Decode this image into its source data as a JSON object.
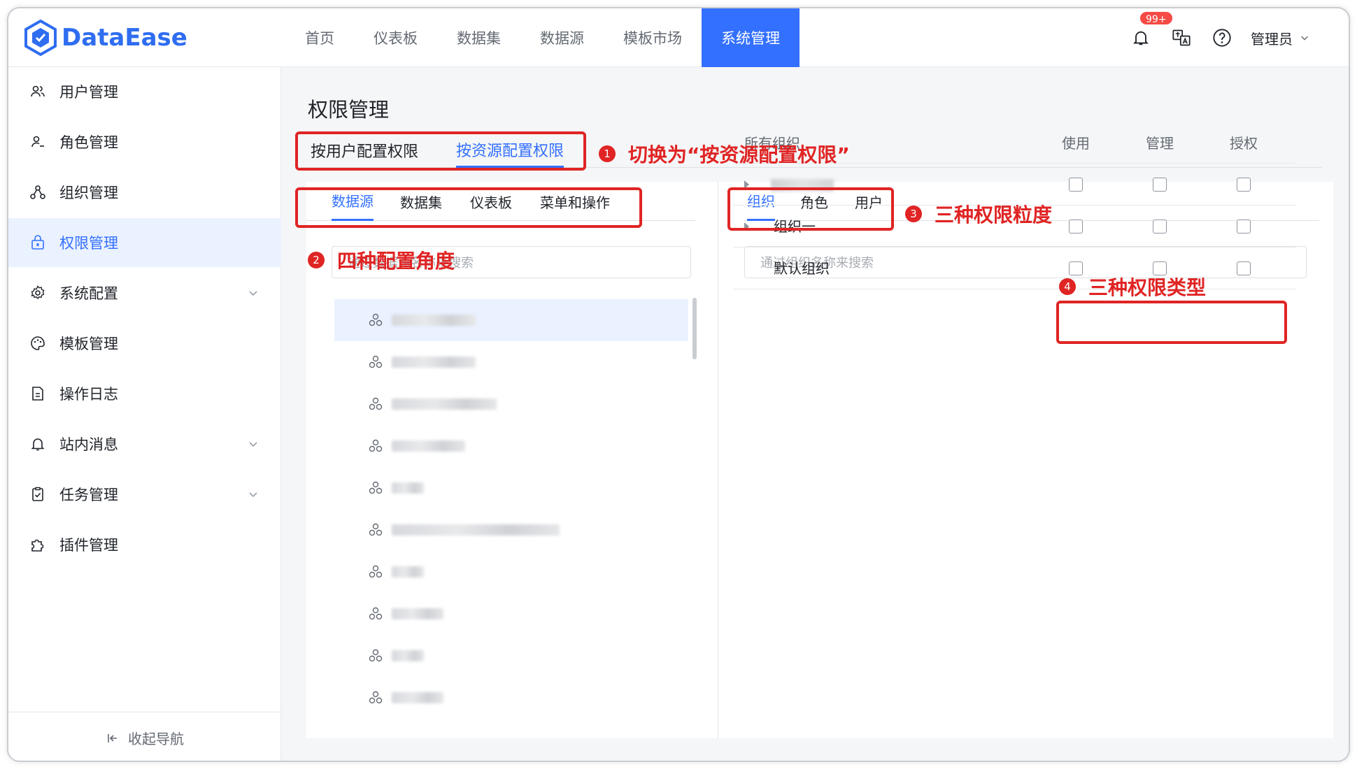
{
  "header": {
    "brand": "DataEase",
    "nav": [
      "首页",
      "仪表板",
      "数据集",
      "数据源",
      "模板市场",
      "系统管理"
    ],
    "active_nav": "系统管理",
    "notification_badge": "99+",
    "user": "管理员"
  },
  "sidebar": {
    "items": [
      {
        "label": "用户管理",
        "icon": "user-icon"
      },
      {
        "label": "角色管理",
        "icon": "role-icon"
      },
      {
        "label": "组织管理",
        "icon": "org-icon"
      },
      {
        "label": "权限管理",
        "icon": "lock-icon"
      },
      {
        "label": "系统配置",
        "icon": "gear-icon"
      },
      {
        "label": "模板管理",
        "icon": "palette-icon"
      },
      {
        "label": "操作日志",
        "icon": "doc-icon"
      },
      {
        "label": "站内消息",
        "icon": "bell-icon"
      },
      {
        "label": "任务管理",
        "icon": "clipboard-icon"
      },
      {
        "label": "插件管理",
        "icon": "plugin-icon"
      }
    ],
    "active": "权限管理",
    "collapse_label": "收起导航"
  },
  "main": {
    "title": "权限管理",
    "mode_tabs": [
      "按用户配置权限",
      "按资源配置权限"
    ],
    "active_mode": "按资源配置权限",
    "resource_tabs": [
      "数据源",
      "数据集",
      "仪表板",
      "菜单和操作"
    ],
    "active_resource": "数据源",
    "resource_search_placeholder": "通过数据源名称来搜索",
    "granularity_tabs": [
      "组织",
      "角色",
      "用户"
    ],
    "active_granularity": "组织",
    "granularity_search_placeholder": "通过组织名称来搜索",
    "table": {
      "header": "所有组织",
      "columns": [
        "使用",
        "管理",
        "授权"
      ],
      "rows": [
        {
          "name": "",
          "expandable": true
        },
        {
          "name": "组织一",
          "expandable": true
        },
        {
          "name": "默认组织",
          "expandable": false
        }
      ]
    }
  },
  "annotations": {
    "a1": {
      "num": "1",
      "text": "切换为“按资源配置权限”"
    },
    "a2": {
      "num": "2",
      "text": "四种配置角度"
    },
    "a3": {
      "num": "3",
      "text": "三种权限粒度"
    },
    "a4": {
      "num": "4",
      "text": "三种权限类型"
    }
  },
  "colors": {
    "accent": "#3370ff",
    "annotation": "#e02424"
  }
}
